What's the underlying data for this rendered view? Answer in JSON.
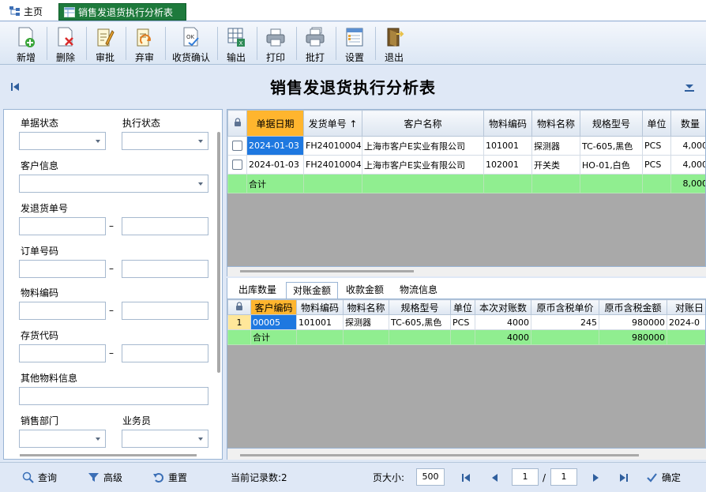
{
  "tabs": {
    "home": "主页",
    "report": "销售发退货执行分析表"
  },
  "toolbar": [
    {
      "label": "新增",
      "icon": "add-doc-icon"
    },
    {
      "label": "删除",
      "icon": "delete-doc-icon"
    },
    {
      "label": "审批",
      "icon": "approve-icon"
    },
    {
      "label": "弃审",
      "icon": "unapprove-icon"
    },
    {
      "label": "收货确认",
      "icon": "confirm-receipt-icon"
    },
    {
      "label": "输出",
      "icon": "export-icon"
    },
    {
      "label": "打印",
      "icon": "print-icon"
    },
    {
      "label": "批打",
      "icon": "batch-print-icon"
    },
    {
      "label": "设置",
      "icon": "settings-icon"
    },
    {
      "label": "退出",
      "icon": "exit-icon"
    }
  ],
  "page_title": "销售发退货执行分析表",
  "filter": {
    "doc_status": "单据状态",
    "exec_status": "执行状态",
    "customer_info": "客户信息",
    "ship_no": "发退货单号",
    "order_no": "订单号码",
    "material_code": "物料编码",
    "inventory_code": "存货代码",
    "other_material": "其他物料信息",
    "sales_dept": "销售部门",
    "salesman": "业务员",
    "range_dash": "–"
  },
  "grid": {
    "headers": [
      "单据日期",
      "发货单号 ↑",
      "客户名称",
      "物料编码",
      "物料名称",
      "规格型号",
      "单位",
      "数量"
    ],
    "rows": [
      [
        "2024-01-03",
        "FH24010004",
        "上海市客户E实业有限公司",
        "101001",
        "探测器",
        "TC-605,黑色",
        "PCS",
        "4,000"
      ],
      [
        "2024-01-03",
        "FH24010004",
        "上海市客户E实业有限公司",
        "102001",
        "开关类",
        "HO-01,白色",
        "PCS",
        "4,000"
      ]
    ],
    "sum_label": "合计",
    "sum_qty": "8,000"
  },
  "detail_tabs": [
    "出库数量",
    "对账金额",
    "收款金额",
    "物流信息"
  ],
  "detail_active": 1,
  "detail": {
    "headers": [
      "客户编码",
      "物料编码",
      "物料名称",
      "规格型号",
      "单位",
      "本次对账数",
      "原币含税单价",
      "原币含税金额",
      "对账日"
    ],
    "rows": [
      [
        "1",
        "00005",
        "101001",
        "探测器",
        "TC-605,黑色",
        "PCS",
        "4000",
        "245",
        "980000",
        "2024-0"
      ]
    ],
    "sum_label": "合计",
    "sum_qty": "4000",
    "sum_amount": "980000"
  },
  "bottom": {
    "query": "查询",
    "advanced": "高级",
    "reset": "重置",
    "record_count": "当前记录数:2",
    "page_size_label": "页大小:",
    "page_size": "500",
    "current_page": "1",
    "page_sep": "/",
    "total_pages": "1",
    "confirm": "确定"
  },
  "colors": {
    "tab_active": "#1e7a3c",
    "summary_row": "#90ee90",
    "selected_header": "#ffb52e",
    "selected_cell": "#1e78e0"
  }
}
